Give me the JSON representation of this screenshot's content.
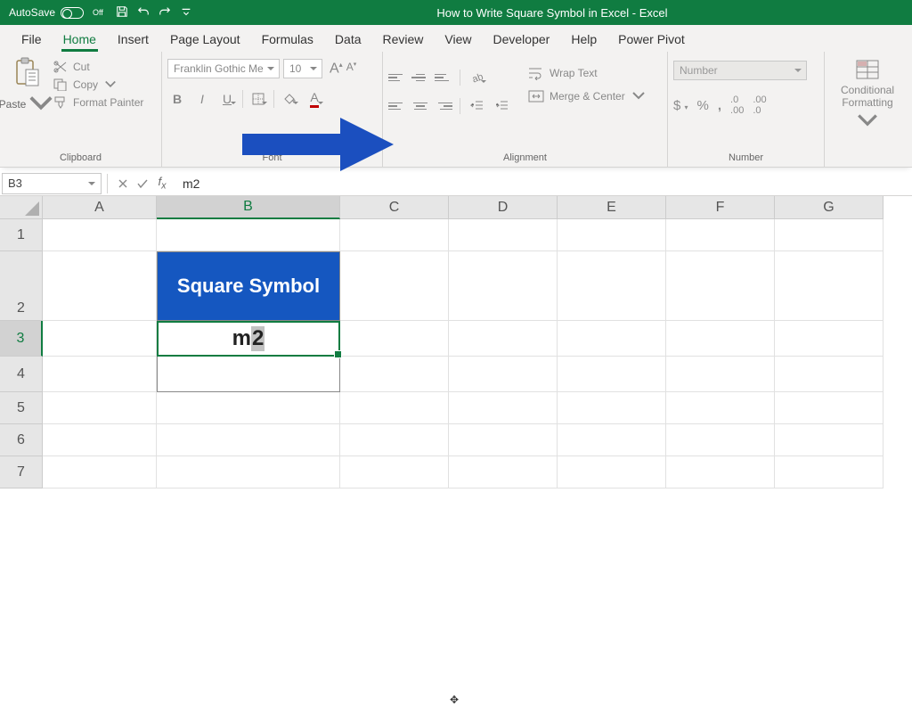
{
  "titlebar": {
    "autosave_label": "AutoSave",
    "autosave_off": "Off",
    "title": "How to Write Square Symbol in Excel  -  Excel"
  },
  "tabs": [
    "File",
    "Home",
    "Insert",
    "Page Layout",
    "Formulas",
    "Data",
    "Review",
    "View",
    "Developer",
    "Help",
    "Power Pivot"
  ],
  "active_tab": "Home",
  "clipboard": {
    "paste": "Paste",
    "cut": "Cut",
    "copy": "Copy",
    "format_painter": "Format Painter",
    "group_label": "Clipboard"
  },
  "font": {
    "name": "Franklin Gothic Me",
    "size": "10",
    "group_label": "Font"
  },
  "alignment": {
    "wrap_text": "Wrap Text",
    "merge_center": "Merge & Center",
    "group_label": "Alignment"
  },
  "number": {
    "format": "Number",
    "group_label": "Number"
  },
  "styles": {
    "conditional_formatting": "Conditional Formatting"
  },
  "formulabar": {
    "name_box": "B3",
    "formula": "m2"
  },
  "grid": {
    "columns": [
      "A",
      "B",
      "C",
      "D",
      "E",
      "F",
      "G"
    ],
    "selected_col": "B",
    "rows": [
      "1",
      "2",
      "3",
      "4",
      "5",
      "6",
      "7"
    ],
    "selected_row": "3",
    "b2": "Square Symbol",
    "b3_pre": "m",
    "b3_sel": "2"
  }
}
